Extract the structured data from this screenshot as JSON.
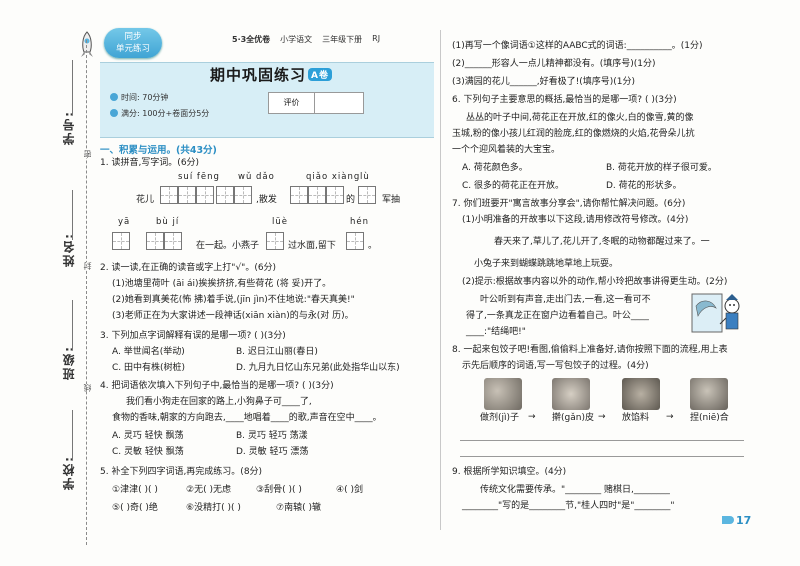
{
  "strip": {
    "labels": [
      "学号:",
      "姓名:",
      "班级:",
      "学校:"
    ],
    "marks": [
      "密",
      "封",
      "线"
    ]
  },
  "header": {
    "badge_line1": "同步",
    "badge_line2": "单元练习",
    "series": "5·3全优卷",
    "subject": "小学语文",
    "grade": "三年级下册",
    "edition": "RJ"
  },
  "title": {
    "text": "期中巩固练习",
    "badge": "A卷",
    "time": "时间: 70分钟",
    "full": "满分: 100分+卷面分5分",
    "score_label": "评价"
  },
  "section1": "一、积累与运用。(共43分)",
  "q1": {
    "title": "1. 读拼音,写字词。(6分)",
    "pinyin_row1": [
      "suí fēng",
      "wǔ dǎo",
      "qiǎo xiàng",
      "lù"
    ],
    "row1_text": [
      "花儿",
      ",散发",
      "的",
      "",
      "军抽"
    ],
    "pinyin_row2": [
      "yā",
      "bù jí",
      "lüè",
      "hén"
    ],
    "row2_text": [
      "在一起。小燕子",
      "过水面,留下",
      "。"
    ]
  },
  "q2": {
    "title": "2. 读一读,在正确的读音或字上打\"√\"。(6分)",
    "lines": [
      "(1)池塘里荷叶 (āi ái)挨挨挤挤,有些荷花 (将 妥)开了。",
      "(2)她看到真美花(怖 拂)着手说,(jīn jìn)不住地说:\"春天真美!\"",
      "(3)老师正在为大家讲述一段神话(xiān xiàn)的与永(对 历)。"
    ]
  },
  "q3": {
    "title": "3. 下列加点字词解释有误的是哪一项? ( )(3分)",
    "options": [
      "A. 举世闻名(举动)",
      "B. 迟日江山丽(春日)",
      "C. 田中有株(树桩)",
      "D. 九月九日忆山东兄弟(此处指华山以东)"
    ]
  },
  "q4": {
    "title": "4. 把词语依次填入下列句子中,最恰当的是哪一项? ( )(3分)",
    "lines": [
      "我们看小狗走在回家的路上,小狗鼻子可____了,",
      "食物的香味,朝家的方向跑去,____地唱着____的歌,声音在空中____。"
    ],
    "options": [
      "A. 灵巧  轻快  飘荡",
      "B. 灵巧  轻巧  荡漾",
      "C. 灵敏  轻快  飘荡",
      "D. 灵敏  轻巧  漂荡"
    ]
  },
  "q5": {
    "title": "5. 补全下列四字词语,再完成练习。(8分)",
    "row1": [
      "①津津(  )(  )",
      "②无(  )无虑",
      "③刮骨(  )(  )",
      "④(  )剑"
    ],
    "row2": [
      "⑤(  )奇(  )绝",
      "⑥没精打(  )(  )",
      "⑦南辕(  )辙",
      ""
    ]
  },
  "right": {
    "r1": "(1)再写一个像词语①这样的AABC式的词语:__________。(1分)",
    "r2": "(2)______形容人一点儿精神都没有。(填序号)(1分)",
    "r3": "(3)满园的花儿______,好看极了!(填序号)(1分)",
    "q6_title": "6. 下列句子主要意思的概括,最恰当的是哪一项? ( )(3分)",
    "q6_text": [
      "丛丛的叶子中间,荷花正在开放,红的像火,白的像雪,黄的像",
      "玉城,粉的像小孩儿红润的脸庞,红的像燃烧的火焰,花骨朵儿抗",
      "一个个迎风着装的大宝宝。"
    ],
    "q6_options": [
      "A. 荷花颜色多。",
      "B. 荷花开放的样子很可爱。",
      "C. 很多的荷花正在开放。",
      "D. 荷花的形状多。"
    ],
    "q7_title": "7. 你们班要开\"寓言故事分享会\",请你帮忙解决问题。(6分)",
    "q7_1": "(1)小明准备的开故事以下这段,请用修改符号修改。(4分)",
    "q7_quote": "春天来了,草儿了,花儿开了,冬眠的动物都醒过来了。一",
    "q7_quote2": "小兔子来到蝴蝶跳跳地草地上玩耍。",
    "q7_2": "(2)提示:根据故事内容以外的动作,帮小玲把故事讲得更生动。(2分)",
    "q7_dialog1": "叶公听到有声音,走出门去,一看,这一看可不",
    "q7_dialog2": "得了,一条真龙正在窗户边看着自己。叶公____",
    "q7_dialog3": "____:\"结绳吧!\"",
    "q8_title": "8. 一起来包饺子吧!看图,偷偷料上准备好,请你按照下面的流程,用上表",
    "q8_text": "示先后顺序的词语,写一写包饺子的过程。(4分)",
    "q8_steps": [
      "做剂(jì)子",
      "擀(gǎn)皮",
      "放馅料",
      "捏(niē)合"
    ],
    "q9_title": "9. 根据所学知识填空。(4分)",
    "q9_l1": "传统文化需要传承。\"________ 赌棋日,________",
    "q9_l2": "________\"写的是________节,\"桂人四时\"是\"________\""
  },
  "page_number": "17"
}
